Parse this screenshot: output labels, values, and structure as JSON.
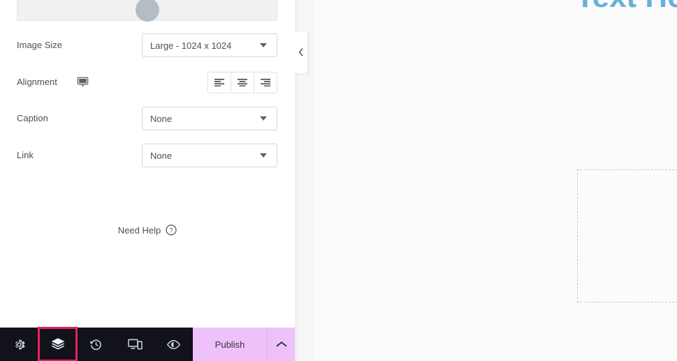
{
  "panel": {
    "media_preview": {
      "name": "image-preview-thumbnail",
      "placeholder_icon": "image-placeholder-circle-icon"
    },
    "controls": [
      {
        "id": "image-size",
        "label": "Image Size",
        "type": "select",
        "value": "Large - 1024 x 1024"
      },
      {
        "id": "alignment",
        "label": "Alignment",
        "type": "align-group",
        "device_icon": "desktop-icon",
        "options": [
          "align-left",
          "align-center",
          "align-right"
        ],
        "selected": null
      },
      {
        "id": "caption",
        "label": "Caption",
        "type": "select",
        "value": "None"
      },
      {
        "id": "link",
        "label": "Link",
        "type": "select",
        "value": "None"
      }
    ],
    "need_help": {
      "label": "Need Help",
      "icon": "question-mark-circle-icon"
    },
    "collapse_tab": {
      "icon": "chevron-left-icon",
      "title": "Hide Panel"
    }
  },
  "bottom_bar": {
    "background": "#11121a",
    "tools": [
      {
        "id": "settings",
        "icon": "gear-icon",
        "label": "Settings",
        "highlighted": false
      },
      {
        "id": "navigator",
        "icon": "layers-icon",
        "label": "Navigator",
        "highlighted": true
      },
      {
        "id": "history",
        "icon": "history-clock-icon",
        "label": "History",
        "highlighted": false
      },
      {
        "id": "responsive",
        "icon": "responsive-devices-icon",
        "label": "Responsive Mode",
        "highlighted": false
      },
      {
        "id": "preview",
        "icon": "eye-icon",
        "label": "Preview Changes",
        "highlighted": false
      }
    ],
    "publish": {
      "label": "Publish",
      "background": "#efc1fa",
      "more_icon": "chevron-up-icon"
    },
    "highlight_color": "#e8215b"
  },
  "preview": {
    "heading": "Text He",
    "heading_color": "#68b0d8",
    "empty_container": "dashed-empty-container"
  }
}
